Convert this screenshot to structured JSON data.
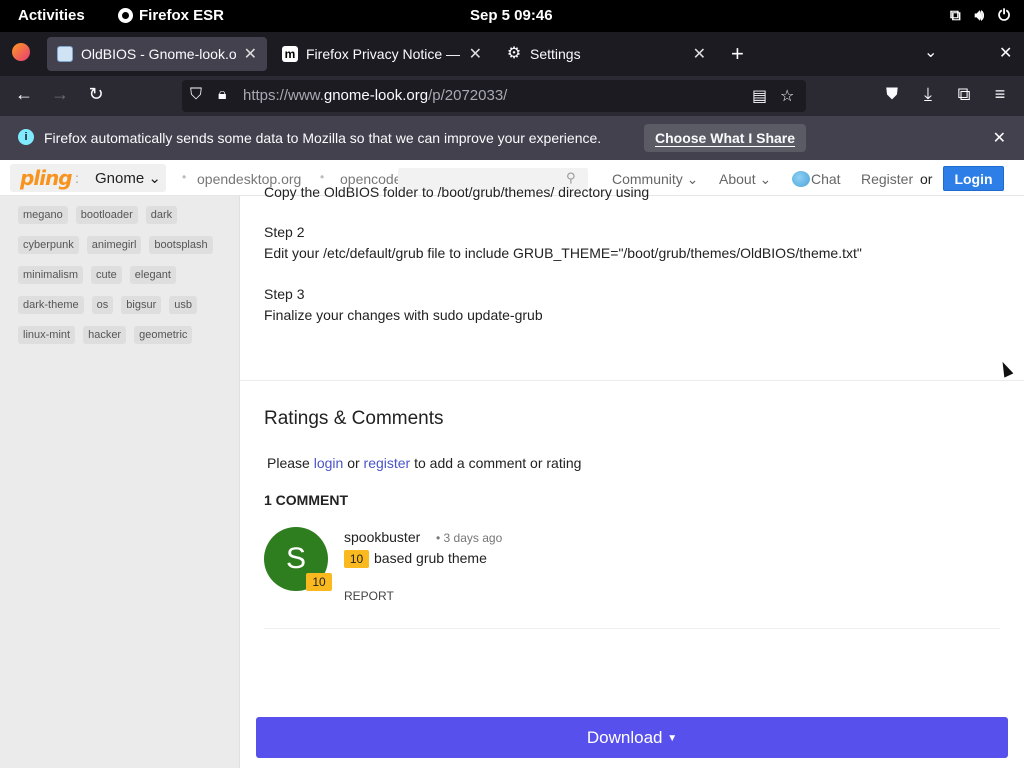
{
  "system_bar": {
    "activities": "Activities",
    "app_name": "Firefox ESR",
    "clock": "Sep 5  09:46",
    "tray_icons": [
      "network-icon",
      "volume-icon",
      "power-icon"
    ]
  },
  "browser": {
    "tabs": [
      {
        "title": "OldBIOS - Gnome-look.o",
        "active": true,
        "favicon": "gnome-look-favicon"
      },
      {
        "title": "Firefox Privacy Notice — M",
        "active": false,
        "favicon": "mozilla-favicon"
      },
      {
        "title": "Settings",
        "active": false,
        "favicon": "gear-icon"
      }
    ],
    "new_tab": "+",
    "url_prefix": "https://www.",
    "url_domain": "gnome-look.org",
    "url_path": "/p/2072033/",
    "notification": {
      "message": "Firefox automatically sends some data to Mozilla so that we can improve your experience.",
      "button": "Choose What I Share"
    }
  },
  "site_header": {
    "logo": "pling",
    "colon": ":",
    "store": "Gnome ⌄",
    "links": [
      "opendesktop.org",
      "opencode"
    ],
    "search_placeholder": "",
    "menu": {
      "community": "Community ⌄",
      "about": "About ⌄",
      "chat": "Chat",
      "register": "Register",
      "or": "or",
      "login": "Login"
    }
  },
  "sidebar": {
    "tag_rows": [
      [
        "megano",
        "bootloader",
        "dark"
      ],
      [
        "cyberpunk",
        "animegirl",
        "bootsplash"
      ],
      [
        "minimalism",
        "cute",
        "elegant"
      ],
      [
        "dark-theme",
        "os",
        "bigsur",
        "usb"
      ],
      [
        "linux-mint",
        "hacker",
        "geometric"
      ]
    ]
  },
  "main": {
    "cut_text": "Copy the OldBIOS folder to /boot/grub/themes/ directory using",
    "steps": [
      {
        "title": "Step 2",
        "text": "Edit your /etc/default/grub file to include GRUB_THEME=\"/boot/grub/themes/OldBIOS/theme.txt\""
      },
      {
        "title": "Step 3",
        "text": "Finalize your changes with sudo update-grub"
      }
    ],
    "ratings_title": "Ratings & Comments",
    "please": "Please",
    "login_link": "login",
    "or": "or",
    "register_link": "register",
    "please_suffix": "to add a comment or rating",
    "comment_count": "1 COMMENT",
    "comment": {
      "avatar_letter": "S",
      "avatar_color": "#2e7d1e",
      "rating": "10",
      "user": "spookbuster",
      "time": "• 3 days ago",
      "text": "based grub theme",
      "report": "REPORT"
    },
    "download": "Download"
  },
  "colors": {
    "download_button": "#5850ec",
    "login_button": "#2d7ee6",
    "rating_badge": "#f9b91f",
    "link": "#4a54c7"
  }
}
